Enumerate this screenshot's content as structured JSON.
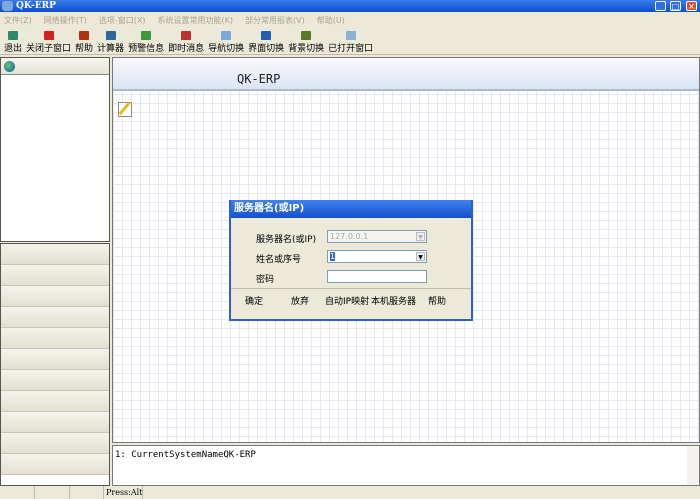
{
  "window": {
    "title": "QK-ERP"
  },
  "menu": [
    "文件(Z)",
    "网络操作(T)",
    "选项-窗口(X)",
    "系统设置常用功能(K)",
    "部分常用报表(V)",
    "帮助(U)"
  ],
  "toolbar": [
    {
      "label": "退出",
      "icon": "exit-icon",
      "color": "#2a8a6a"
    },
    {
      "label": "关闭子窗口",
      "icon": "close-icon",
      "color": "#d02020"
    },
    {
      "label": "帮助",
      "icon": "help-book-icon",
      "color": "#b03010"
    },
    {
      "label": "计算器",
      "icon": "calculator-icon",
      "color": "#2a6a9a"
    },
    {
      "label": "预警信息",
      "icon": "warning-doc-icon",
      "color": "#3a9a3a"
    },
    {
      "label": "即时消息",
      "icon": "message-icon",
      "color": "#c03030"
    },
    {
      "label": "导航切换",
      "icon": "navigation-icon",
      "color": "#7aa8d8"
    },
    {
      "label": "界面切换",
      "icon": "globe-icon",
      "color": "#2060b0"
    },
    {
      "label": "背景切换",
      "icon": "background-icon",
      "color": "#5a7a2a"
    },
    {
      "label": "已打开窗口",
      "icon": "windows-icon",
      "color": "#8ab0d8"
    }
  ],
  "main": {
    "title": "QK-ERP"
  },
  "dialog": {
    "title": "服务器名(或IP)",
    "server_label": "服务器名(或IP)",
    "server_value": "127.0.0.1",
    "user_label": "姓名或序号",
    "user_value": "1",
    "password_label": "密码",
    "password_value": "",
    "buttons": [
      "确定",
      "放弃",
      "自动IP映射",
      "本机服务器",
      "帮助"
    ]
  },
  "log": {
    "line": "1: CurrentSystemNameQK-ERP"
  },
  "status": {
    "text": "Press:Alt"
  }
}
